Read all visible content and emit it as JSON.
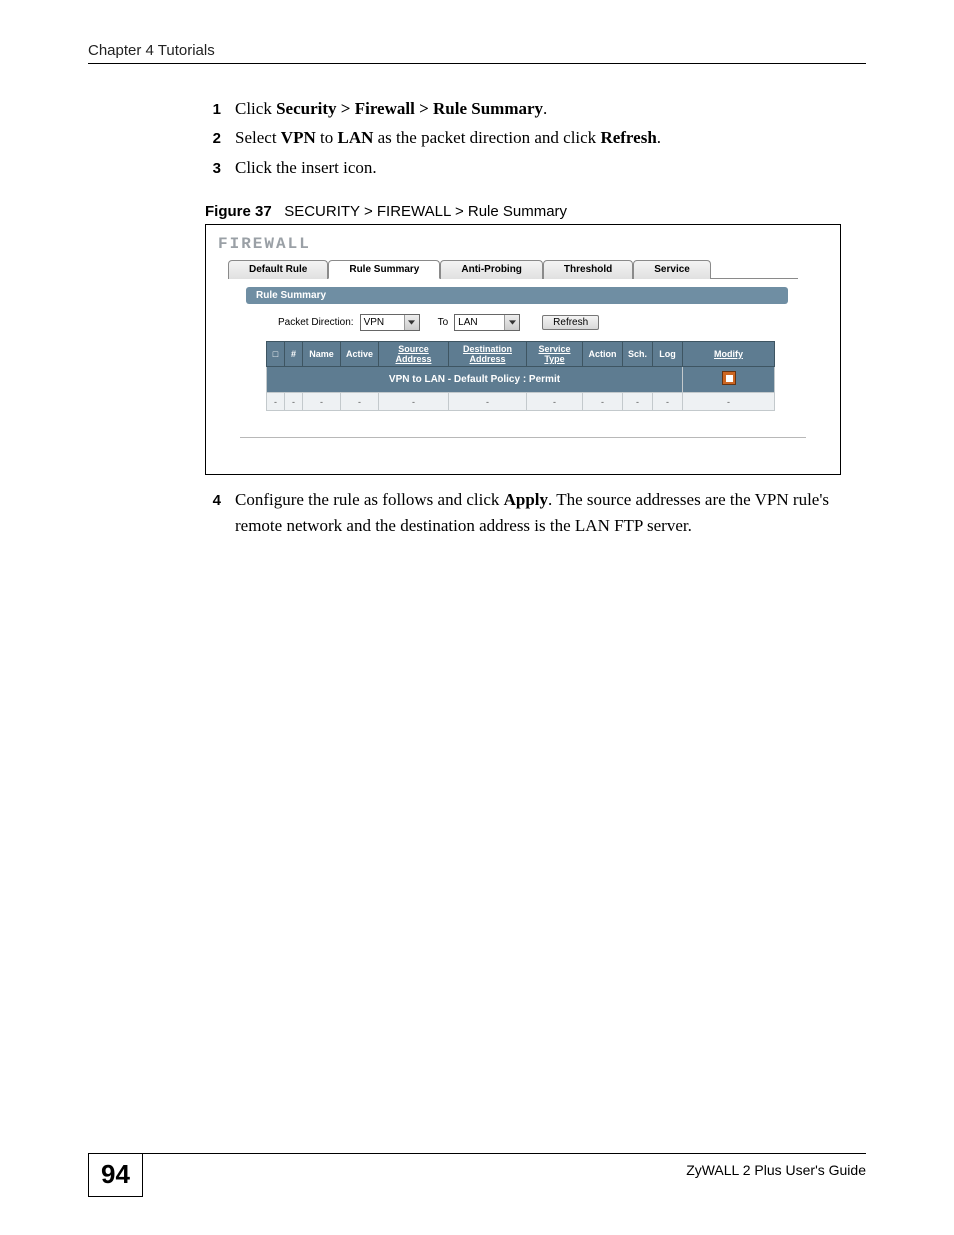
{
  "header": {
    "chapter": "Chapter 4 Tutorials"
  },
  "steps": [
    {
      "num": "1",
      "parts": [
        "Click ",
        "Security > Firewall > Rule Summary",
        "."
      ]
    },
    {
      "num": "2",
      "parts": [
        "Select ",
        "VPN",
        " to ",
        "LAN",
        " as the packet direction and click ",
        "Refresh",
        "."
      ]
    },
    {
      "num": "3",
      "parts": [
        "Click the insert icon."
      ]
    }
  ],
  "figure": {
    "label": "Figure 37",
    "caption": "SECURITY > FIREWALL > Rule Summary"
  },
  "firewall": {
    "title": "FIREWALL",
    "tabs": [
      "Default Rule",
      "Rule Summary",
      "Anti-Probing",
      "Threshold",
      "Service"
    ],
    "active_tab_index": 1,
    "section_title": "Rule Summary",
    "packet_direction_label": "Packet Direction:",
    "from_value": "VPN",
    "to_label": "To",
    "to_value": "LAN",
    "refresh_label": "Refresh",
    "columns": {
      "expand": "□",
      "hash": "#",
      "name": "Name",
      "active": "Active",
      "source": "Source Address",
      "dest": "Destination Address",
      "service": "Service Type",
      "action": "Action",
      "sch": "Sch.",
      "log": "Log",
      "modify": "Modify"
    },
    "policy_row": "VPN to LAN - Default Policy : Permit",
    "empty_row": [
      "-",
      "-",
      "-",
      "-",
      "-",
      "-",
      "-",
      "-",
      "-",
      "-",
      "-"
    ]
  },
  "step4": {
    "num": "4",
    "text_a": "Configure the rule as follows and click ",
    "bold": "Apply",
    "text_b": ". The source addresses are the VPN rule's remote network and the destination address is the LAN FTP server."
  },
  "footer": {
    "page": "94",
    "guide": "ZyWALL 2 Plus User's Guide"
  }
}
